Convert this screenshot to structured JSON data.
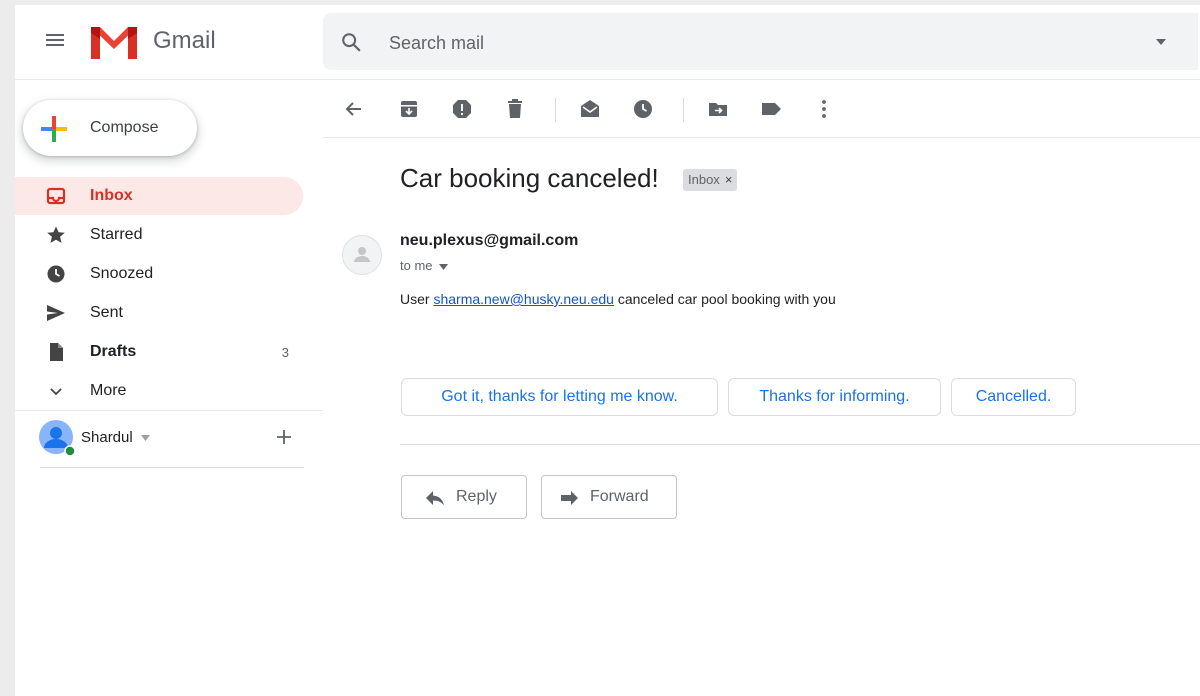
{
  "header": {
    "product_name": "Gmail",
    "search_placeholder": "Search mail",
    "logo_colors": {
      "red": "#d93025",
      "dark_red": "#b31412"
    }
  },
  "sidebar": {
    "compose_label": "Compose",
    "nav_items": [
      {
        "label": "Inbox",
        "icon": "inbox-icon",
        "active": true,
        "bold": true
      },
      {
        "label": "Starred",
        "icon": "star-icon"
      },
      {
        "label": "Snoozed",
        "icon": "clock-icon"
      },
      {
        "label": "Sent",
        "icon": "send-icon"
      },
      {
        "label": "Drafts",
        "icon": "draft-icon",
        "bold": true,
        "count": "3"
      },
      {
        "label": "More",
        "icon": "chevron-down-icon"
      }
    ],
    "account_name": "Shardul",
    "account_status_color": "#1e8e3e"
  },
  "toolbar": {
    "buttons": [
      "back-icon",
      "archive-icon",
      "report-spam-icon",
      "delete-icon",
      "mark-unread-icon",
      "snooze-icon",
      "move-to-icon",
      "label-icon",
      "more-vert-icon"
    ]
  },
  "message": {
    "subject": "Car booking canceled!",
    "label_chip": "Inbox",
    "label_close": "×",
    "sender": "neu.plexus@gmail.com",
    "recipient": "to me",
    "body_prefix": "User ",
    "body_link": "sharma.new@husky.neu.edu",
    "body_suffix": " canceled car pool booking with you"
  },
  "smart_replies": [
    "Got it, thanks for letting me know.",
    "Thanks for informing.",
    "Cancelled."
  ],
  "actions": {
    "reply": "Reply",
    "forward": "Forward"
  },
  "colors": {
    "accent_blue": "#1a73e8",
    "active_bg": "#fce8e6",
    "active_text": "#d93025"
  }
}
